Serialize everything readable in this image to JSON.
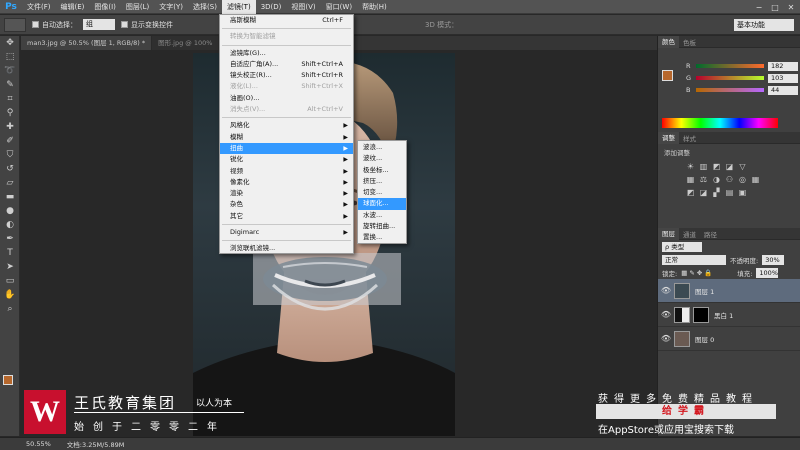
{
  "app": {
    "logo": "Ps",
    "window_controls": [
      "−",
      "□",
      "✕"
    ]
  },
  "menubar": [
    {
      "label": "文件(F)"
    },
    {
      "label": "编辑(E)"
    },
    {
      "label": "图像(I)"
    },
    {
      "label": "图层(L)"
    },
    {
      "label": "文字(Y)"
    },
    {
      "label": "选择(S)"
    },
    {
      "label": "滤镜(T)"
    },
    {
      "label": "3D(D)"
    },
    {
      "label": "视图(V)"
    },
    {
      "label": "窗口(W)"
    },
    {
      "label": "帮助(H)"
    }
  ],
  "options": {
    "auto_select_label": "自动选择：",
    "auto_select_value": "组",
    "show_transform_label": "显示变换控件",
    "mode_3d": "3D 模式：",
    "workspace": "基本功能"
  },
  "doc_tabs": [
    {
      "label": "man3.jpg @ 50.5% (图层 1, RGB/8) *",
      "active": true
    },
    {
      "label": "图形.jpg @ 100%",
      "active": false
    }
  ],
  "filter_menu": {
    "items": [
      {
        "label": "高斯模糊",
        "shortcut": "Ctrl+F",
        "type": "item"
      },
      {
        "type": "sep"
      },
      {
        "label": "转换为智能滤镜",
        "type": "disabled"
      },
      {
        "type": "sep"
      },
      {
        "label": "滤镜库(G)...",
        "type": "item"
      },
      {
        "label": "自适应广角(A)...",
        "shortcut": "Shift+Ctrl+A",
        "type": "item"
      },
      {
        "label": "镜头校正(R)...",
        "shortcut": "Shift+Ctrl+R",
        "type": "item"
      },
      {
        "label": "液化(L)...",
        "shortcut": "Shift+Ctrl+X",
        "type": "disabled"
      },
      {
        "label": "油画(O)...",
        "type": "item"
      },
      {
        "label": "消失点(V)...",
        "shortcut": "Alt+Ctrl+V",
        "type": "disabled"
      },
      {
        "type": "sep"
      },
      {
        "label": "风格化",
        "type": "submenu"
      },
      {
        "label": "模糊",
        "type": "submenu"
      },
      {
        "label": "扭曲",
        "type": "submenu",
        "highlight": true
      },
      {
        "label": "锐化",
        "type": "submenu"
      },
      {
        "label": "视频",
        "type": "submenu"
      },
      {
        "label": "像素化",
        "type": "submenu"
      },
      {
        "label": "渲染",
        "type": "submenu"
      },
      {
        "label": "杂色",
        "type": "submenu"
      },
      {
        "label": "其它",
        "type": "submenu"
      },
      {
        "type": "sep"
      },
      {
        "label": "Digimarc",
        "type": "submenu"
      },
      {
        "type": "sep"
      },
      {
        "label": "浏览联机滤镜...",
        "type": "item"
      }
    ]
  },
  "distort_submenu": [
    {
      "label": "波浪..."
    },
    {
      "label": "波纹..."
    },
    {
      "label": "极坐标..."
    },
    {
      "label": "挤压..."
    },
    {
      "label": "切变..."
    },
    {
      "label": "球面化...",
      "highlight": true
    },
    {
      "label": "水波..."
    },
    {
      "label": "旋转扭曲..."
    },
    {
      "label": "置换..."
    }
  ],
  "color_panel": {
    "tabs": [
      "颜色",
      "色板"
    ],
    "sliders": [
      {
        "label": "R",
        "value": "182"
      },
      {
        "label": "G",
        "value": "103"
      },
      {
        "label": "B",
        "value": "44"
      }
    ],
    "fg_color": "#b6672c"
  },
  "adjust_panel": {
    "tabs": [
      "调整",
      "样式"
    ],
    "title": "添加调整",
    "rows": [
      [
        "☀",
        "▥",
        "◩",
        "◪",
        "▽"
      ],
      [
        "▦",
        "⚖",
        "◑",
        "⚇",
        "◎",
        "▦"
      ],
      [
        "◩",
        "◪",
        "▞",
        "▤",
        "▣"
      ]
    ]
  },
  "layers_panel": {
    "tabs": [
      "图层",
      "通道",
      "路径"
    ],
    "kind_label": "ρ 类型",
    "blend_mode": "正常",
    "opacity_label": "不透明度:",
    "opacity": "30%",
    "lock_label": "锁定:",
    "fill_label": "填充:",
    "fill": "100%",
    "layers": [
      {
        "name": "图层 1",
        "selected": true
      },
      {
        "name": "黑白 1",
        "selected": false
      },
      {
        "name": "图层 0",
        "selected": false
      }
    ]
  },
  "status": {
    "zoom": "50.55%",
    "doc": "文档:3.25M/5.89M"
  },
  "brand": {
    "logo": "W",
    "title": "王氏教育集团",
    "slogan": "以人为本",
    "sub": "始创于二零零二年"
  },
  "promo": {
    "top": "获得更多免费精品教程",
    "bar": "给学霸",
    "bottom": "在AppStore或应用宝搜索下载"
  }
}
